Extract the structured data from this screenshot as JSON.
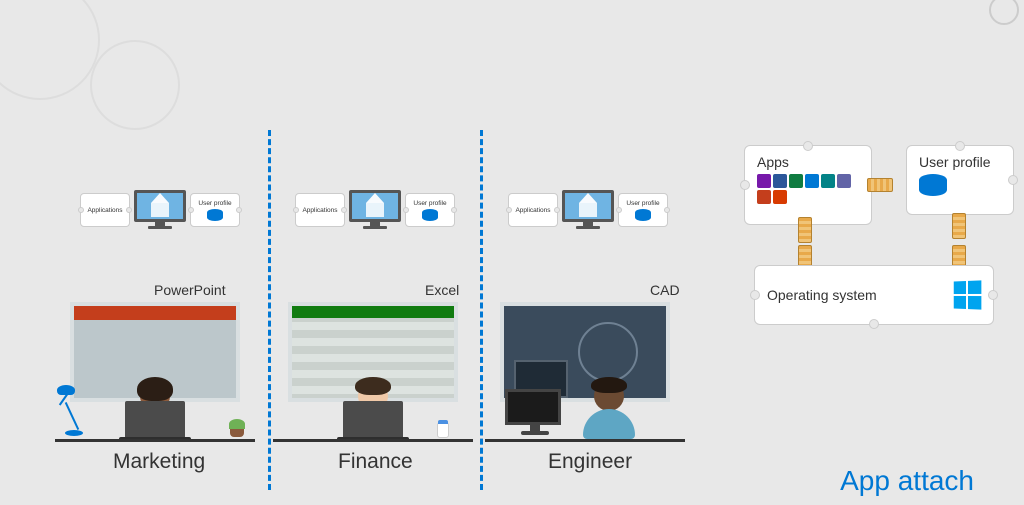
{
  "workstation": {
    "app_label": "Applications",
    "profile_label": "User profile"
  },
  "personas": [
    {
      "role": "Marketing",
      "app": "PowerPoint"
    },
    {
      "role": "Finance",
      "app": "Excel"
    },
    {
      "role": "Engineer",
      "app": "CAD"
    }
  ],
  "tickets": {
    "apps": "Apps",
    "profile": "User profile",
    "os": "Operating system"
  },
  "footer": "App attach",
  "icons": {
    "cube": "cube-icon",
    "database": "database-icon",
    "windows": "windows-logo-icon",
    "lamp": "desk-lamp-icon",
    "cupcake": "cupcake-icon",
    "coffee": "coffee-cup-icon"
  },
  "app_icon_colors": [
    "#7719AA",
    "#2B579A",
    "#107C41",
    "#0078D4",
    "#C43E1C",
    "#038387",
    "#D83B01",
    "#CA5010"
  ]
}
